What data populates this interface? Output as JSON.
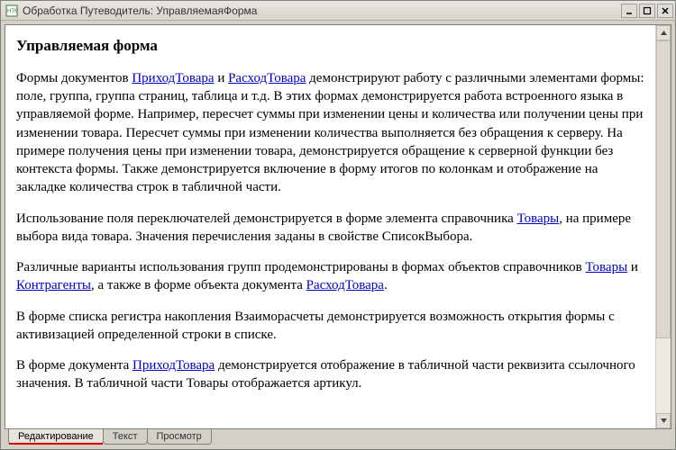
{
  "window": {
    "title": "Обработка Путеводитель: УправляемаяФорма"
  },
  "doc": {
    "heading": "Управляемая форма",
    "p1_a": "Формы документов ",
    "p1_link1": "ПриходТовара",
    "p1_b": " и ",
    "p1_link2": "РасходТовара",
    "p1_c": " демонстрируют работу с различными элементами формы: поле, группа, группа страниц, таблица и т.д. В этих формах демонстрируется работа встроенного языка в управляемой форме. Например, пересчет суммы при изменении цены и количества или получении цены при изменении товара. Пересчет суммы  при изменении  количества выполняется без обращения к серверу. На примере получения цены при изменении товара, демонстрируется обращение к серверной функции без контекста формы. Также демонстрируется включение в форму итогов по колонкам и отображение на закладке количества строк в табличной части.",
    "p2_a": "Использование поля переключателей демонстрируется в форме элемента справочника ",
    "p2_link1": "Товары",
    "p2_b": ", на примере выбора вида товара. Значения перечисления заданы в свойстве СписокВыбора.",
    "p3_a": "Различные варианты использования групп продемонстрированы в формах объектов справочников ",
    "p3_link1": "Товары",
    "p3_b": " и ",
    "p3_link2": "Контрагенты",
    "p3_c": ", а также в форме объекта документа ",
    "p3_link3": "РасходТовара",
    "p3_d": ".",
    "p4": "В форме списка регистра накопления Взаиморасчеты демонстрируется возможность открытия формы с активизацией определенной строки в списке.",
    "p5_a": "В форме документа ",
    "p5_link1": "ПриходТовара",
    "p5_b": " демонстрируется отображение в табличной части реквизита ссылочного значения. В табличной части Товары отображается артикул."
  },
  "tabs": {
    "items": [
      {
        "label": "Редактирование",
        "active": true
      },
      {
        "label": "Текст",
        "active": false
      },
      {
        "label": "Просмотр",
        "active": false
      }
    ]
  }
}
